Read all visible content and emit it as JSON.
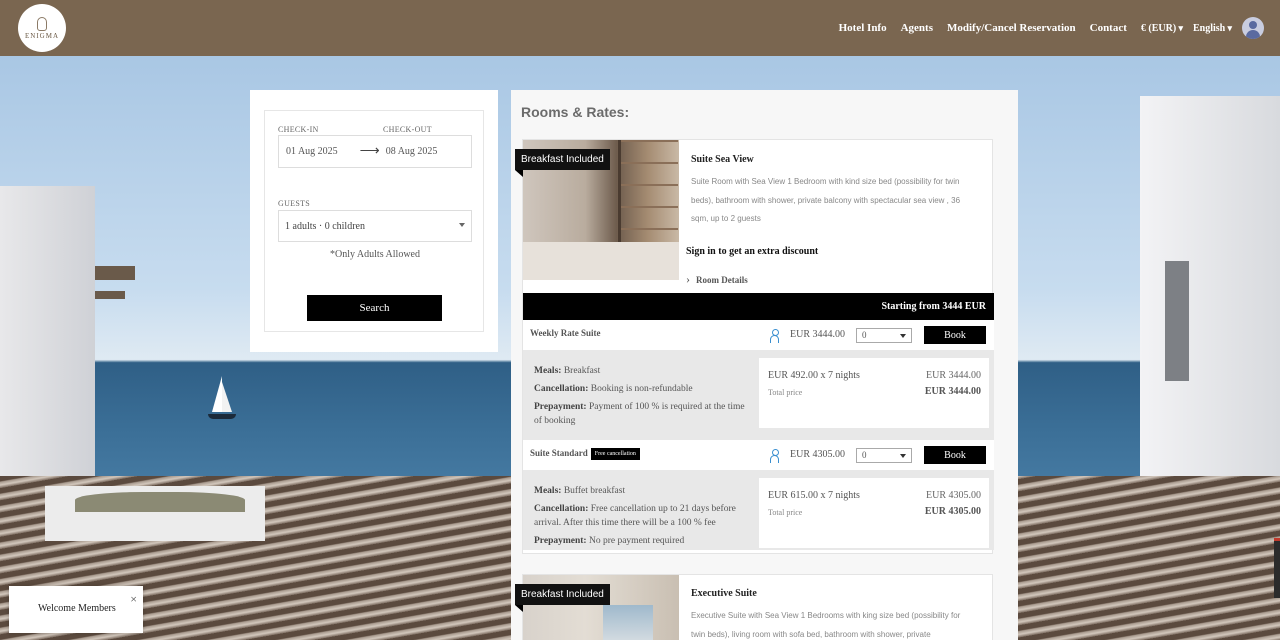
{
  "header": {
    "logo_text": "ENIGMA",
    "nav": [
      "Hotel Info",
      "Agents",
      "Modify/Cancel Reservation",
      "Contact"
    ],
    "currency": "€ (EUR)",
    "language": "English"
  },
  "search": {
    "checkin_label": "CHECK-IN",
    "checkout_label": "CHECK-OUT",
    "checkin": "01 Aug 2025",
    "checkout": "08 Aug 2025",
    "guests_label": "GUESTS",
    "guests": "1 adults · 0 children",
    "note": "*Only Adults Allowed",
    "button": "Search"
  },
  "rooms": {
    "title": "Rooms & Rates:",
    "items": [
      {
        "badge": "Breakfast Included",
        "name": "Suite Sea View",
        "desc": "Suite Room with Sea View 1 Bedroom with kind size bed (possibility for twin beds), bathroom with shower, private balcony with spectacular sea view , 36 sqm, up to 2 guests",
        "signin": "Sign in to get an extra discount",
        "details": "Room Details",
        "starting": "Starting from 3444 EUR",
        "rates": [
          {
            "name": "Weekly Rate Suite",
            "free": "",
            "price": "EUR 3444.00",
            "qty": "0",
            "book": "Book",
            "meals_label": "Meals:",
            "meals": "Breakfast",
            "cancel_label": "Cancellation:",
            "cancel": "Booking is non-refundable",
            "prepay_label": "Prepayment:",
            "prepay": "Payment of 100 % is required at the time of booking",
            "calc": "EUR 492.00 x 7 nights",
            "sub": "EUR 3444.00",
            "total_label": "Total price",
            "total": "EUR 3444.00"
          },
          {
            "name": "Suite Standard",
            "free": "Free cancellation",
            "price": "EUR 4305.00",
            "qty": "0",
            "book": "Book",
            "meals_label": "Meals:",
            "meals": "Buffet breakfast",
            "cancel_label": "Cancellation:",
            "cancel": "Free cancellation up to 21 days before arrival. After this time there will be a 100 % fee",
            "prepay_label": "Prepayment:",
            "prepay": "No pre payment required",
            "calc": "EUR 615.00 x 7 nights",
            "sub": "EUR 4305.00",
            "total_label": "Total price",
            "total": "EUR 4305.00"
          }
        ]
      },
      {
        "badge": "Breakfast Included",
        "name": "Executive Suite",
        "desc": "Executive Suite with Sea View 1 Bedrooms with king size bed (possibility for twin beds), living room with sofa bed, bathroom with shower, private"
      }
    ]
  },
  "popup": {
    "text": "Welcome Members",
    "close": "×"
  }
}
